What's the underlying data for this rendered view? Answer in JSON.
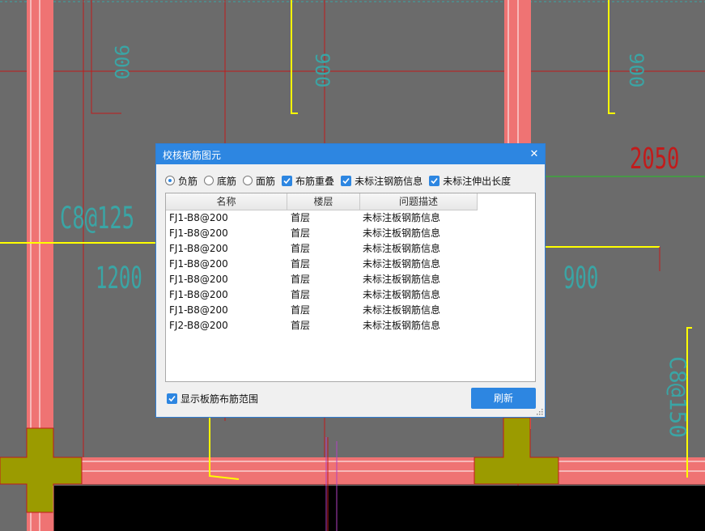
{
  "cad_labels": {
    "dim_2050": "2050",
    "dim_900": "900",
    "dim_1200": "1200",
    "rebar_c8_125": "C8@125",
    "rebar_c8_150": "C8@150",
    "small_900_a": "900",
    "small_900_b": "900",
    "small_900_c": "900"
  },
  "colors": {
    "canvas": "#6b6b6b",
    "beam": "#ef7373",
    "column": "#9b9b00",
    "rebar": "#ffff00",
    "dimension_cyan": "#3aa5a5",
    "dimension_red": "#c21b1b",
    "accent": "#2d86e1"
  },
  "dialog": {
    "title": "校核板筋图元",
    "close_glyph": "✕",
    "options": {
      "radio_negative": "负筋",
      "radio_bottom": "底筋",
      "radio_top": "面筋",
      "check_overlap": "布筋重叠",
      "check_unlabeled_info": "未标注钢筋信息",
      "check_unlabeled_length": "未标注伸出长度",
      "selected_radio": "负筋"
    },
    "table": {
      "headers": [
        "名称",
        "楼层",
        "问题描述"
      ],
      "rows": [
        [
          "FJ1-B8@200",
          "首层",
          "未标注板钢筋信息"
        ],
        [
          "FJ1-B8@200",
          "首层",
          "未标注板钢筋信息"
        ],
        [
          "FJ1-B8@200",
          "首层",
          "未标注板钢筋信息"
        ],
        [
          "FJ1-B8@200",
          "首层",
          "未标注板钢筋信息"
        ],
        [
          "FJ1-B8@200",
          "首层",
          "未标注板钢筋信息"
        ],
        [
          "FJ1-B8@200",
          "首层",
          "未标注板钢筋信息"
        ],
        [
          "FJ1-B8@200",
          "首层",
          "未标注板钢筋信息"
        ],
        [
          "FJ2-B8@200",
          "首层",
          "未标注板钢筋信息"
        ]
      ]
    },
    "show_range_label": "显示板筋布筋范围",
    "refresh_label": "刷新"
  }
}
